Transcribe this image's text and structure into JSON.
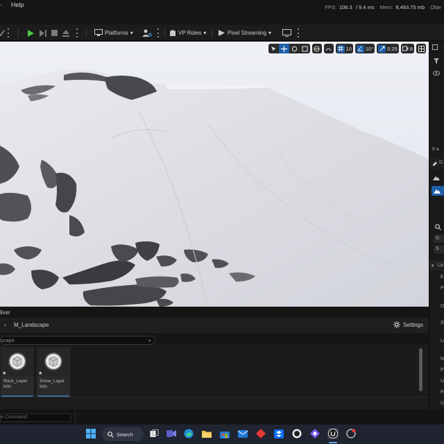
{
  "menubar": {
    "help_label": "Help"
  },
  "stats": {
    "fps_label": "FPS:",
    "fps_value": "106.3",
    "ms_value": "/ 9.4 ms",
    "mem_label": "Mem:",
    "mem_value": "8,493.75 mb",
    "obj_label": "Obje"
  },
  "toolbar": {
    "platforms_label": "Platforms",
    "vp_roles_label": "VP Roles",
    "pixel_streaming_label": "Pixel Streaming"
  },
  "viewport": {
    "grid_value": "10",
    "angle_value": "10°",
    "scale_value": "0.25",
    "camera_speed_value": "8"
  },
  "details": {
    "count_label": "9 a",
    "d_label": "D",
    "g_label": "G",
    "s_label": "S",
    "la_label": "La",
    "en_label": "En",
    "pe_label": "Pe",
    "de_label": "De",
    "st_label": "St",
    "lo_label": "Lo",
    "nu_label": "N",
    "pr_label": "Pr",
    "us_label": "Us",
    "fi_label": "Fi",
    "us2_label": "Us"
  },
  "mixer": {
    "title": "lixer",
    "material_label": "M_Landscape",
    "settings_label": "Settings",
    "search_placeholder": "scape",
    "layers": [
      {
        "line1": "Rock_Layer",
        "line2": "Info"
      },
      {
        "line1": "Snow_Layer",
        "line2": "Info"
      }
    ]
  },
  "statusbar": {
    "command_placeholder": "e Command"
  },
  "taskbar": {
    "search_label": "Search"
  },
  "colors": {
    "accent_blue": "#1e5fa8",
    "play_green": "#4cc84c",
    "taskbar_bg": "#1f2430"
  }
}
